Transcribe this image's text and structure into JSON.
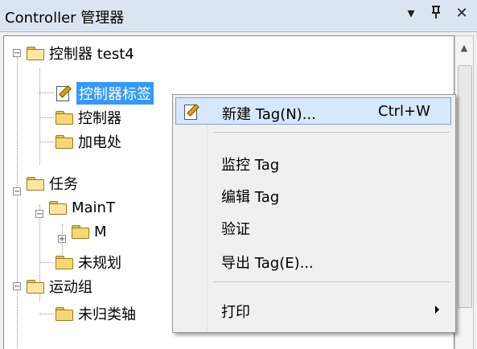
{
  "panel": {
    "title": "Controller 管理器",
    "dropdown_icon": "▾",
    "pin_icon": "ᵖ",
    "close_icon": "✕"
  },
  "tree": {
    "controller": "控制器 test4",
    "controller_tags": "控制器标签",
    "controller_fault": "控制器",
    "powerup": "加电处",
    "tasks": "任务",
    "main_task": "MainT",
    "main_program": "M",
    "unscheduled": "未规划",
    "motion_groups": "运动组",
    "unassigned_axes": "未归类轴"
  },
  "context_menu": {
    "new_tag": "新建 Tag(N)...",
    "new_tag_shortcut": "Ctrl+W",
    "monitor_tag": "监控 Tag",
    "edit_tag": "编辑 Tag",
    "verify": "验证",
    "export_tag": "导出 Tag(E)...",
    "print": "打印"
  },
  "colors": {
    "selection": "#3399ff",
    "menu_highlight": "#d6e8fb",
    "title_bar": "#dbe5f1"
  }
}
